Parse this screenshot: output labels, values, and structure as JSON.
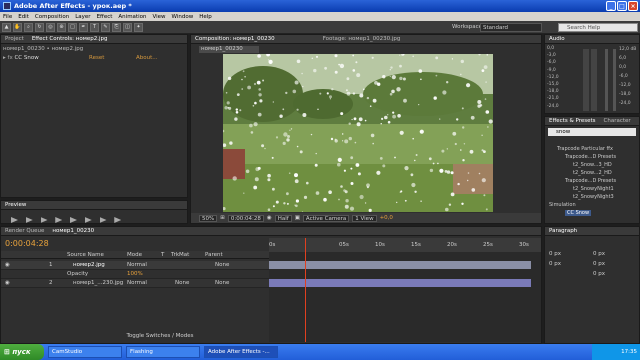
{
  "window": {
    "title": "Adobe After Effects - урок.aep *"
  },
  "menu": [
    "File",
    "Edit",
    "Composition",
    "Layer",
    "Effect",
    "Animation",
    "View",
    "Window",
    "Help"
  ],
  "workspace": {
    "label": "Workspace:",
    "value": "Standard"
  },
  "search": {
    "placeholder": "Search Help"
  },
  "left_panel": {
    "tabs": [
      "Project",
      "Effect Controls: номер2.jpg"
    ],
    "breadcrumb": "номер1_00230 • номер2.jpg",
    "effect_name": "CC Snow",
    "reset": "Reset",
    "about": "About..."
  },
  "preview": {
    "tab": "Preview"
  },
  "comp_panel": {
    "tabs": [
      "Composition: номер1_00230",
      "Footage: номер1_00230.jpg"
    ],
    "comp_tab": "номер1_00230",
    "zoom": "50%",
    "timecode": "0:00:04:28",
    "resolution": "Half",
    "camera": "Active Camera",
    "view": "1 View",
    "offset": "+0,0"
  },
  "audio": {
    "tab": "Audio",
    "levels": [
      "0,0",
      "-3,0",
      "-6,0",
      "-9,0",
      "-12,0",
      "-15,0",
      "-18,0",
      "-21,0",
      "-24,0"
    ],
    "right": [
      "12,0 dB",
      "6,0",
      "0,0",
      "-6,0",
      "-12,0",
      "-18,0",
      "-24,0"
    ]
  },
  "effects_presets": {
    "tabs": [
      "Effects & Presets",
      "Character"
    ],
    "search": "snow",
    "items": [
      "Trapcode Particular ffx",
      "Trapcode...D Presets",
      "t2_Snow...3_HD",
      "t2_Snow...2_HD",
      "Trapcode...D Presets",
      "t2_SnowyNight1",
      "t2_SnowyNight3",
      "Simulation",
      "CC Snow"
    ]
  },
  "timeline": {
    "tabs": [
      "Render Queue",
      "номер1_00230"
    ],
    "timecode": "0:00:04:28",
    "columns": [
      "Source Name",
      "Mode",
      "T",
      "TrkMat",
      "Parent"
    ],
    "layers": [
      {
        "num": "1",
        "name": "номер2.jpg",
        "mode": "Normal",
        "trkmat": "",
        "parent": "None"
      },
      {
        "num": "2",
        "name": "номер1_...230.jpg",
        "mode": "Normal",
        "trkmat": "None",
        "parent": "None"
      }
    ],
    "opacity_label": "Opacity",
    "opacity_value": "100%",
    "ruler": [
      "0s",
      "05s",
      "10s",
      "15s",
      "20s",
      "25s",
      "30s"
    ],
    "toggle": "Toggle Switches / Modes"
  },
  "paragraph": {
    "tab": "Paragraph",
    "fields": [
      "0 px",
      "0 px",
      "0 px",
      "0 px",
      "0 px"
    ]
  },
  "taskbar": {
    "start": "пуск",
    "tasks": [
      "CamStudio",
      "Flashing",
      "Adobe After Effects -..."
    ],
    "clock": "17:35"
  }
}
